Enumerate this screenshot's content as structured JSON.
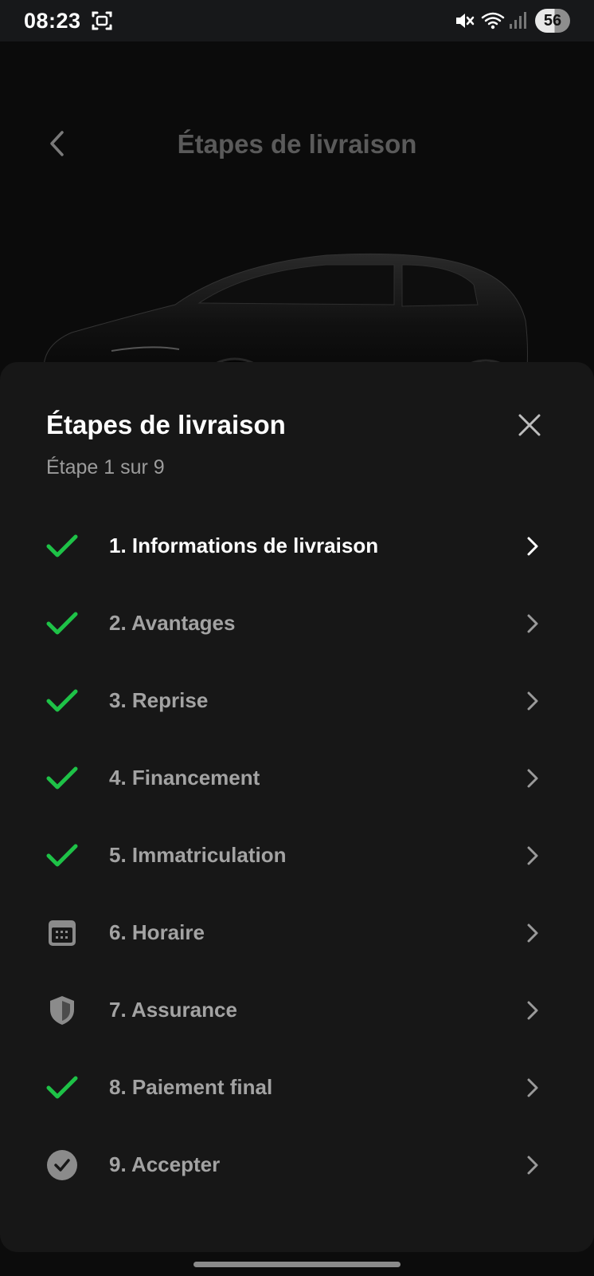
{
  "status_bar": {
    "time": "08:23",
    "battery": "56",
    "icons": [
      "screen-record-icon",
      "mute-icon",
      "wifi-icon",
      "signal-icon"
    ]
  },
  "header": {
    "title": "Étapes de livraison",
    "back_icon": "chevron-left-icon"
  },
  "sheet": {
    "title": "Étapes de livraison",
    "subtitle": "Étape 1 sur 9",
    "close_icon": "close-icon",
    "steps": [
      {
        "label": "1. Informations de livraison",
        "icon": "check-icon",
        "active": true
      },
      {
        "label": "2. Avantages",
        "icon": "check-icon",
        "active": false
      },
      {
        "label": "3. Reprise",
        "icon": "check-icon",
        "active": false
      },
      {
        "label": "4. Financement",
        "icon": "check-icon",
        "active": false
      },
      {
        "label": "5. Immatriculation",
        "icon": "check-icon",
        "active": false
      },
      {
        "label": "6. Horaire",
        "icon": "calendar-icon",
        "active": false
      },
      {
        "label": "7. Assurance",
        "icon": "shield-icon",
        "active": false
      },
      {
        "label": "8. Paiement final",
        "icon": "check-icon",
        "active": false
      },
      {
        "label": "9. Accepter",
        "icon": "check-circle-icon",
        "active": false
      }
    ]
  },
  "colors": {
    "check_green": "#1ec247",
    "sheet_bg": "#171717",
    "muted_text": "#a3a3a3",
    "icon_gray": "#8b8b8b"
  }
}
